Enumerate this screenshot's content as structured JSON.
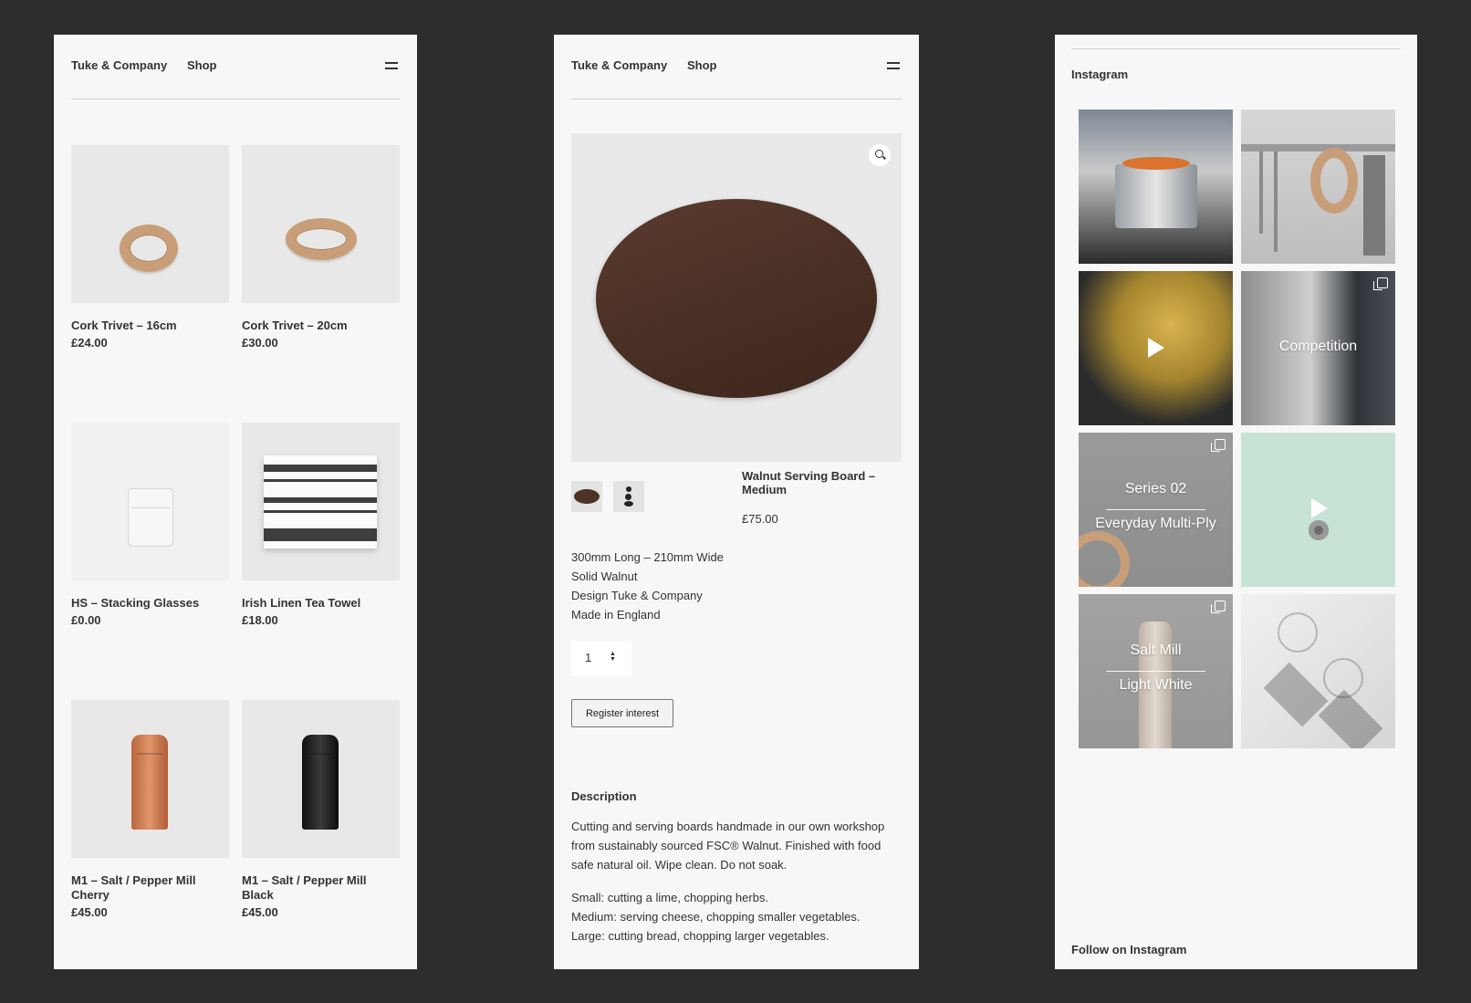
{
  "header": {
    "brand": "Tuke & Company",
    "shop_label": "Shop",
    "menu_icon": "hamburger-icon"
  },
  "shop": {
    "products": [
      {
        "title": "Cork Trivet – 16cm",
        "price": "£24.00"
      },
      {
        "title": "Cork Trivet – 20cm",
        "price": "£30.00"
      },
      {
        "title": "HS – Stacking Glasses",
        "price": "£0.00"
      },
      {
        "title": "Irish Linen Tea Towel",
        "price": "£18.00"
      },
      {
        "title": "M1 – Salt / Pepper Mill",
        "subtitle": "Cherry",
        "price": "£45.00"
      },
      {
        "title": "M1 – Salt / Pepper Mill",
        "subtitle": "Black",
        "price": "£45.00"
      }
    ]
  },
  "product": {
    "title_line1": "Walnut Serving Board –",
    "title_line2": "Medium",
    "price": "£75.00",
    "specs": [
      "300mm Long – 210mm Wide",
      "Solid Walnut",
      "Design Tuke & Company",
      "Made in England"
    ],
    "quantity": "1",
    "register_label": "Register interest",
    "description_heading": "Description",
    "description": "Cutting and serving boards handmade in our own workshop from sustainably sourced FSC® Walnut. Finished with food safe natural oil. Wipe clean. Do not soak.",
    "uses": [
      "Small: cutting a lime, chopping herbs.",
      "Medium: serving cheese, chopping smaller vegetables.",
      "Large: cutting bread, chopping larger vegetables."
    ]
  },
  "instagram": {
    "title": "Instagram",
    "follow_label": "Follow on Instagram",
    "tiles": [
      {
        "caption": ""
      },
      {
        "caption": ""
      },
      {
        "caption": ""
      },
      {
        "caption": "Competition"
      },
      {
        "caption": "Series 02",
        "caption2": "Everyday Multi-Ply"
      },
      {
        "caption": ""
      },
      {
        "caption": "Salt Mill",
        "caption2": "Light White"
      },
      {
        "caption": ""
      }
    ]
  },
  "colors": {
    "page_bg": "#2d2d2d",
    "panel_bg": "#f7f7f7",
    "walnut": "#4a2f24",
    "mint": "#c6e3d6"
  }
}
